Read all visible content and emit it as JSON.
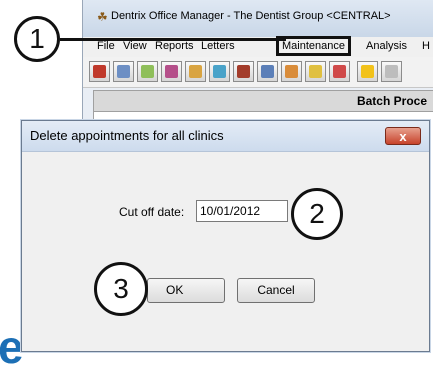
{
  "app": {
    "title": "Dentrix Office Manager - The Dentist Group <CENTRAL>",
    "menu": [
      "File",
      "View",
      "Reports",
      "Letters",
      "Maintenance",
      "Analysis",
      "H"
    ],
    "section_header": "Batch Proce"
  },
  "dialog": {
    "title": "Delete appointments for all clinics",
    "close_label": "x",
    "cutoff_label": "Cut off date:",
    "cutoff_value": "10/01/2012",
    "ok_label": "OK",
    "cancel_label": "Cancel"
  },
  "callouts": [
    "1",
    "2",
    "3"
  ],
  "background_glyph": "e",
  "colors": {
    "maintenance_highlight": "#111111",
    "close_button": "#c7432b"
  }
}
